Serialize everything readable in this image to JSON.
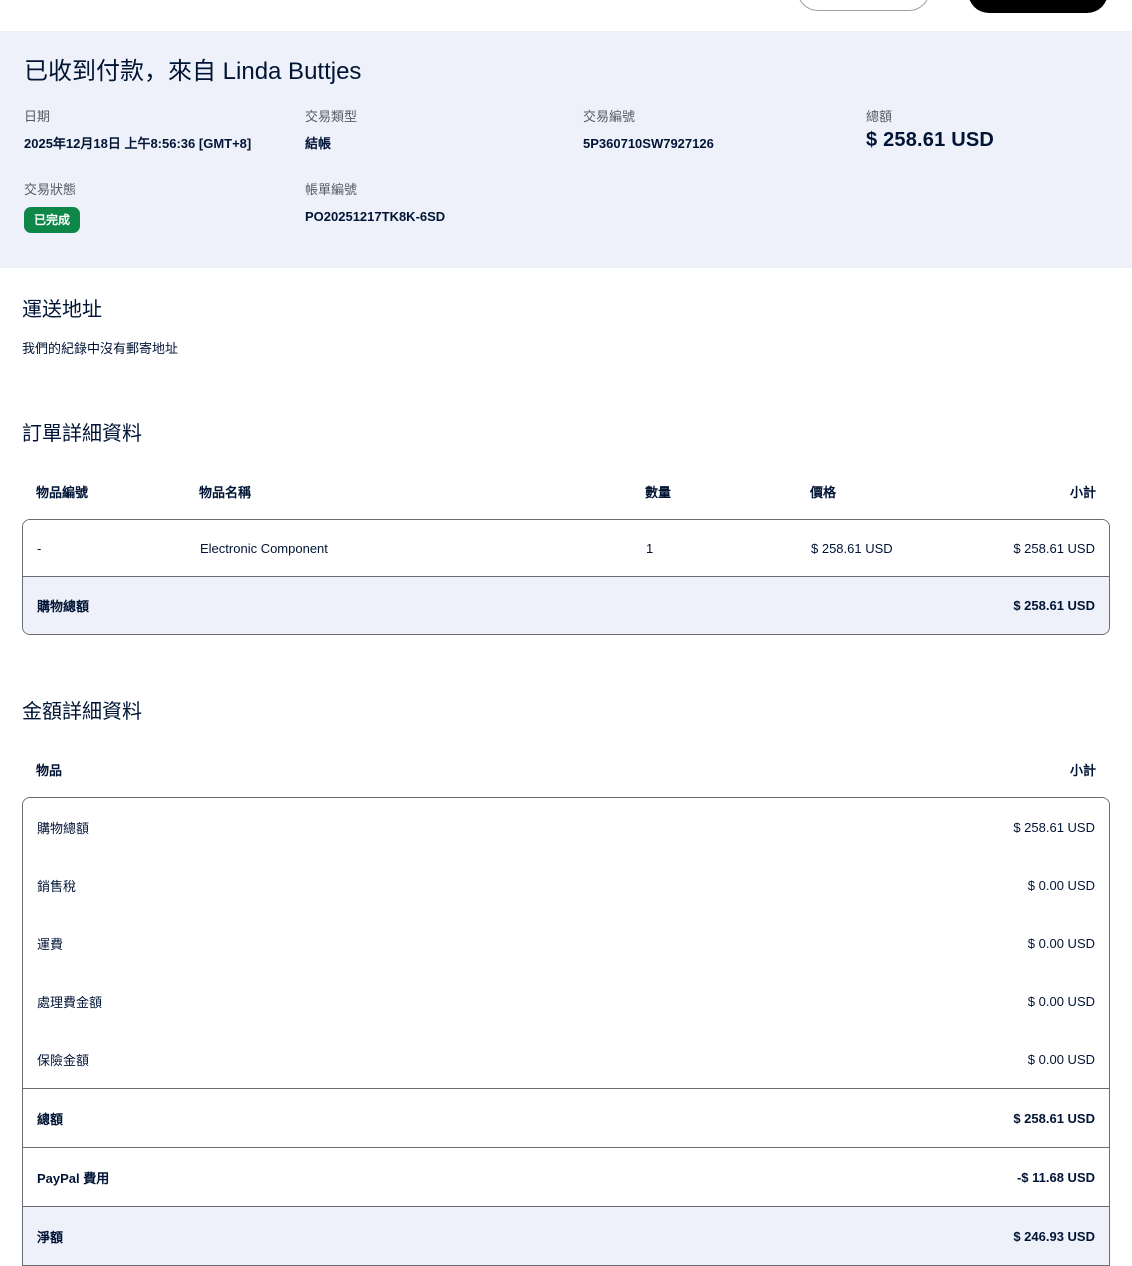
{
  "page": {
    "title": "已收到付款，來自 Linda Buttjes"
  },
  "summary": {
    "fields": [
      {
        "label": "日期",
        "value": "2025年12月18日 上午8:56:36 [GMT+8]"
      },
      {
        "label": "交易類型",
        "value": "結帳"
      },
      {
        "label": "交易編號",
        "value": "5P360710SW7927126"
      },
      {
        "label": "總額",
        "value": "$ 258.61 USD"
      }
    ],
    "status": {
      "label": "交易狀態",
      "value": "已完成"
    },
    "invoice": {
      "label": "帳單編號",
      "value": "PO20251217TK8K-6SD"
    }
  },
  "shipping": {
    "heading": "運送地址",
    "note": "我們的紀錄中沒有郵寄地址"
  },
  "order": {
    "heading": "訂單詳細資料",
    "columns": {
      "item_no": "物品編號",
      "name": "物品名稱",
      "qty": "數量",
      "price": "價格",
      "subtotal": "小計"
    },
    "rows": [
      {
        "item_no": "-",
        "name": "Electronic Component",
        "qty": "1",
        "price": "$ 258.61 USD",
        "subtotal": "$ 258.61 USD"
      }
    ],
    "footer": {
      "label": "購物總額",
      "value": "$ 258.61 USD"
    }
  },
  "amounts": {
    "heading": "金額詳細資料",
    "columns": {
      "item": "物品",
      "subtotal": "小計"
    },
    "rows": [
      {
        "label": "購物總額",
        "value": "$ 258.61 USD"
      },
      {
        "label": "銷售稅",
        "value": "$ 0.00 USD"
      },
      {
        "label": "運費",
        "value": "$ 0.00 USD"
      },
      {
        "label": "處理費金額",
        "value": "$ 0.00 USD"
      },
      {
        "label": "保險金額",
        "value": "$ 0.00 USD"
      },
      {
        "label": "總額",
        "value": "$ 258.61 USD"
      },
      {
        "label": "PayPal 費用",
        "value": "-$ 11.68 USD"
      },
      {
        "label": "淨額",
        "value": "$ 246.93 USD"
      }
    ]
  },
  "colors": {
    "status_green": "#0e8749",
    "hero_bg": "#eef1f9",
    "highlight_row_bg": "#eef1f9"
  }
}
